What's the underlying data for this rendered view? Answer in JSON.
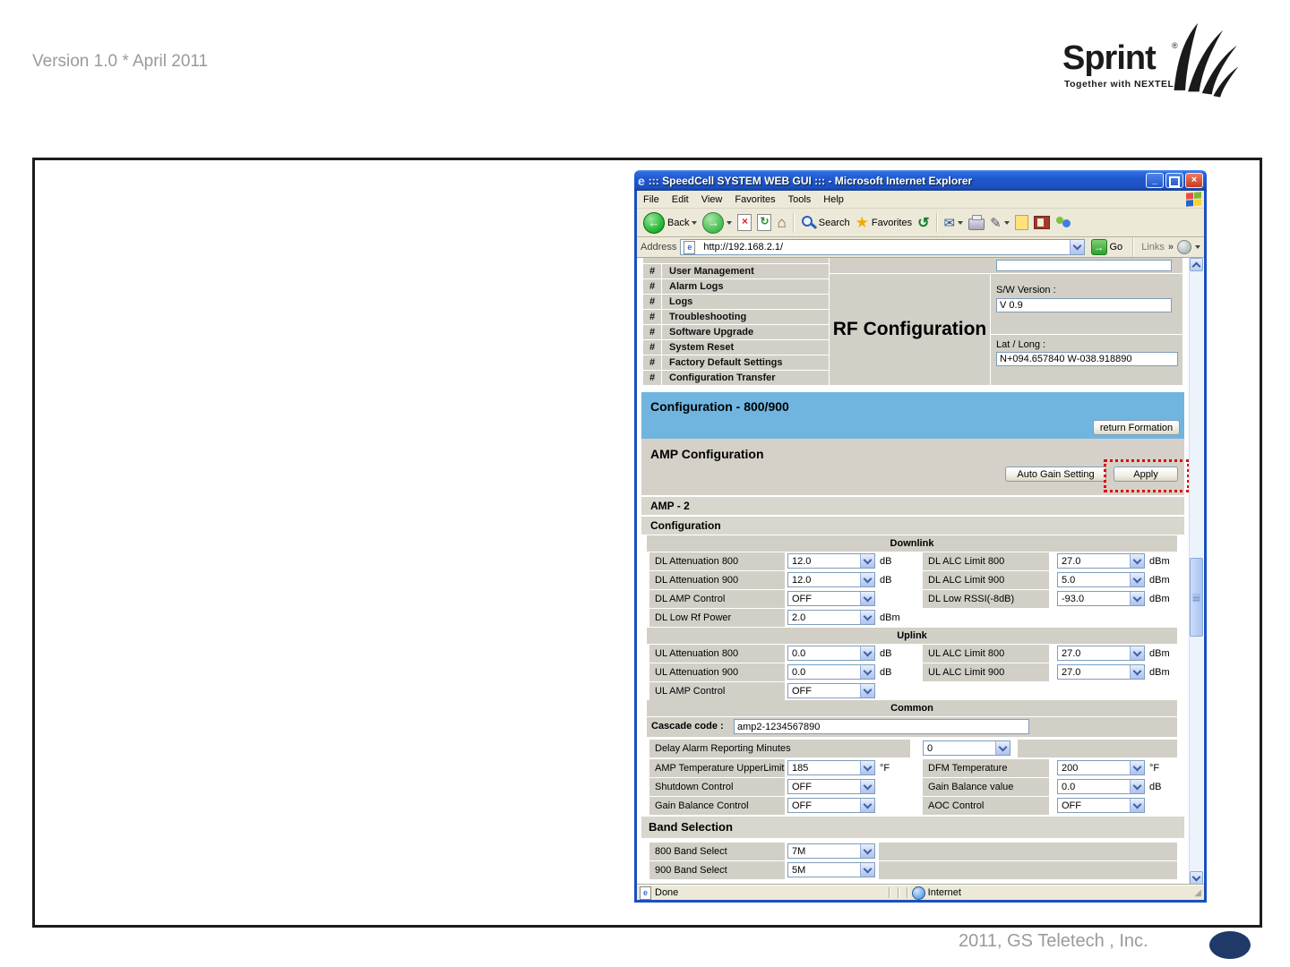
{
  "page": {
    "version_label": "Version 1.0 * April 2011",
    "footer": "2011, GS Teletech , Inc."
  },
  "brand": {
    "name": "Sprint",
    "reg": "®",
    "tagline": "Together with NEXTEL"
  },
  "window": {
    "title": "::: SpeedCell SYSTEM WEB GUI ::: - Microsoft Internet Explorer",
    "menu": [
      "File",
      "Edit",
      "View",
      "Favorites",
      "Tools",
      "Help"
    ],
    "toolbar": {
      "back": "Back",
      "search": "Search",
      "favorites": "Favorites"
    },
    "address": {
      "label": "Address",
      "url": "http://192.168.2.1/",
      "go": "Go",
      "links": "Links"
    },
    "status": {
      "done": "Done",
      "zone": "Internet"
    }
  },
  "icons": {
    "title_e": "e",
    "minimize": "_",
    "close": "×",
    "back": "←",
    "forward": "→",
    "stop": "×",
    "refresh": "↻",
    "home": "⌂",
    "favorites_star": "★",
    "history": "↺",
    "mail": "✉",
    "edit": "✎",
    "links_more": "»",
    "hash": "#",
    "resize_grip": "◢",
    "done_page": "e"
  },
  "sidebar": {
    "items": [
      "User Management",
      "Alarm Logs",
      "Logs",
      "Troubleshooting",
      "Software Upgrade",
      "System Reset",
      "Factory Default Settings",
      "Configuration Transfer"
    ]
  },
  "rf": {
    "title": "RF Configuration",
    "sw_label": "S/W Version :",
    "sw_value": "V 0.9",
    "latlong_label": "Lat / Long :",
    "latlong_value": "N+094.657840 W-038.918890"
  },
  "config_banner": {
    "title": "Configuration - 800/900",
    "return_button": "return Formation"
  },
  "amp": {
    "title": "AMP Configuration",
    "auto_gain_button": "Auto Gain Setting",
    "apply_button": "Apply"
  },
  "amp2": {
    "title": "AMP - 2",
    "subtitle": "Configuration"
  },
  "downlink": {
    "header": "Downlink",
    "left": [
      {
        "label": "DL Attenuation 800",
        "value": "12.0",
        "unit": "dB"
      },
      {
        "label": "DL Attenuation 900",
        "value": "12.0",
        "unit": "dB"
      },
      {
        "label": "DL AMP Control",
        "value": "OFF",
        "unit": ""
      },
      {
        "label": "DL Low Rf Power",
        "value": "2.0",
        "unit": "dBm"
      }
    ],
    "right": [
      {
        "label": "DL ALC Limit 800",
        "value": "27.0",
        "unit": "dBm"
      },
      {
        "label": "DL ALC Limit 900",
        "value": "5.0",
        "unit": "dBm"
      },
      {
        "label": "DL Low RSSI(-8dB)",
        "value": "-93.0",
        "unit": "dBm"
      }
    ]
  },
  "uplink": {
    "header": "Uplink",
    "left": [
      {
        "label": "UL Attenuation 800",
        "value": "0.0",
        "unit": "dB"
      },
      {
        "label": "UL Attenuation 900",
        "value": "0.0",
        "unit": "dB"
      },
      {
        "label": "UL AMP Control",
        "value": "OFF",
        "unit": ""
      }
    ],
    "right": [
      {
        "label": "UL ALC Limit 800",
        "value": "27.0",
        "unit": "dBm"
      },
      {
        "label": "UL ALC Limit 900",
        "value": "27.0",
        "unit": "dBm"
      }
    ]
  },
  "common": {
    "header": "Common",
    "cascade_label": "Cascade code :",
    "cascade_value": "amp2-1234567890",
    "delay_label": "Delay Alarm Reporting Minutes",
    "delay_value": "0",
    "left": [
      {
        "label": "AMP Temperature UpperLimit",
        "value": "185",
        "unit": "°F"
      },
      {
        "label": "Shutdown Control",
        "value": "OFF",
        "unit": ""
      },
      {
        "label": "Gain Balance Control",
        "value": "OFF",
        "unit": ""
      }
    ],
    "right": [
      {
        "label": "DFM Temperature UpperLimit",
        "value": "200",
        "unit": "°F"
      },
      {
        "label": "Gain Balance value",
        "value": "0.0",
        "unit": "dB"
      },
      {
        "label": "AOC Control",
        "value": "OFF",
        "unit": ""
      }
    ]
  },
  "band": {
    "header": "Band Selection",
    "rows": [
      {
        "label": "800 Band Select",
        "value": "7M"
      },
      {
        "label": "900 Band Select",
        "value": "5M"
      }
    ]
  },
  "colors": {
    "banner_blue": "#70b5df",
    "section_gray": "#d5d1c9",
    "cell_gray": "#d2cfc7",
    "titlebar_blue": "#1c4fc0",
    "highlight_red": "#e00000",
    "footer_navy": "#1f3a68"
  }
}
